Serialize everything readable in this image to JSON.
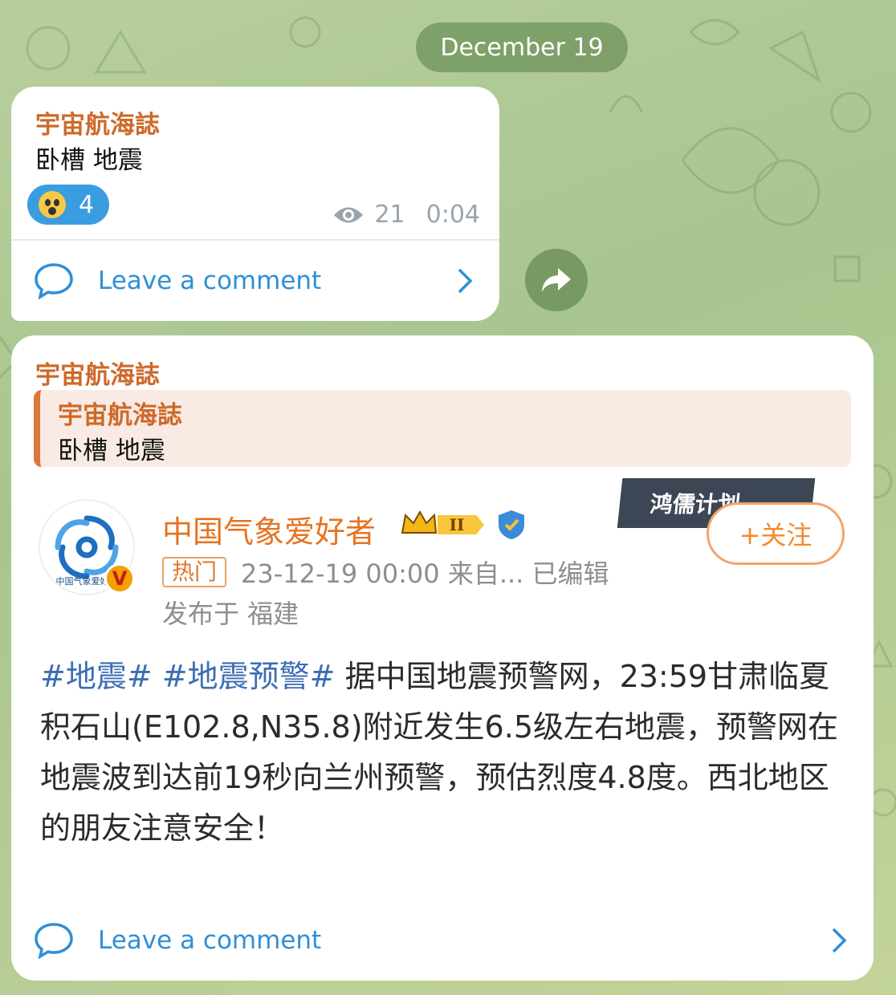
{
  "date_label": "December 19",
  "message1": {
    "author": "宇宙航海誌",
    "text": "卧槽 地震",
    "reaction_count": "4",
    "views": "21",
    "time": "0:04",
    "comment_label": "Leave a comment"
  },
  "message2": {
    "author": "宇宙航海誌",
    "reply": {
      "author": "宇宙航海誌",
      "text": "卧槽 地震"
    },
    "comment_label": "Leave a comment",
    "weibo": {
      "account_name": "中国气象爱好者",
      "logo_text": "中国气象爱好者",
      "level_badge": "II",
      "banner_text": "鸿儒计划",
      "follow_label": "+关注",
      "hot_badge": "热门",
      "meta": "23-12-19 00:00  来自...  已编辑",
      "location": "发布于 福建",
      "tags": [
        "#地震#",
        "#地震预警#"
      ],
      "body_text": "据中国地震预警网，23:59甘肃临夏积石山(E102.8,N35.8)附近发生6.5级左右地震，预警网在地震波到达前19秒向兰州预警，预估烈度4.8度。西北地区的朋友注意安全！"
    }
  },
  "colors": {
    "author": "#cd6a2a",
    "link": "#2f8fd6",
    "reaction_bg": "#3a9de0",
    "weibo_orange": "#e6731f"
  }
}
